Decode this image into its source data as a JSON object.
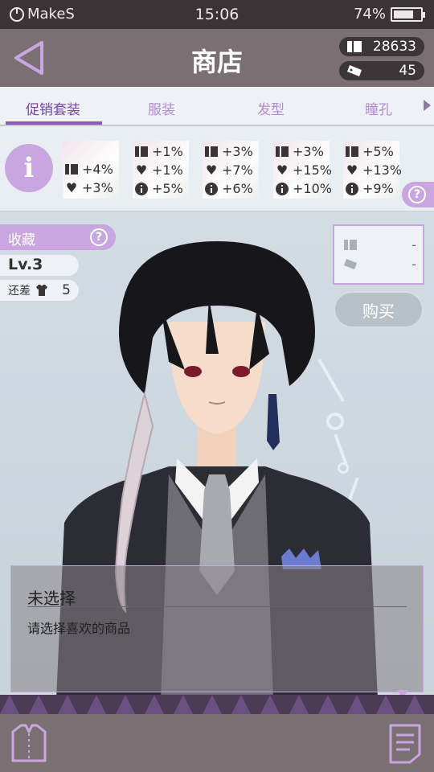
{
  "status_bar": {
    "carrier": "MakeS",
    "time": "15:06",
    "battery": "74%",
    "battery_level": 0.74
  },
  "header": {
    "title": "商店",
    "currency_1": {
      "icon": "card-icon",
      "value": "28633"
    },
    "currency_2": {
      "icon": "ticket-icon",
      "value": "45"
    }
  },
  "tabs": [
    {
      "label": "促销套装"
    },
    {
      "label": "服装"
    },
    {
      "label": "发型"
    },
    {
      "label": "瞳孔"
    }
  ],
  "bonus_cards": [
    {
      "lines": [
        {
          "icon": "card-icon",
          "text": "+4%"
        },
        {
          "icon": "heart-icon",
          "text": "+3%"
        }
      ]
    },
    {
      "lines": [
        {
          "icon": "card-icon",
          "text": "+1%"
        },
        {
          "icon": "heart-icon",
          "text": "+1%"
        },
        {
          "icon": "info-icon",
          "text": "+5%"
        }
      ]
    },
    {
      "lines": [
        {
          "icon": "card-icon",
          "text": "+3%"
        },
        {
          "icon": "heart-icon",
          "text": "+7%"
        },
        {
          "icon": "info-icon",
          "text": "+6%"
        }
      ]
    },
    {
      "lines": [
        {
          "icon": "card-icon",
          "text": "+3%"
        },
        {
          "icon": "heart-icon",
          "text": "+15%"
        },
        {
          "icon": "info-icon",
          "text": "+10%"
        }
      ]
    },
    {
      "lines": [
        {
          "icon": "card-icon",
          "text": "+5%"
        },
        {
          "icon": "heart-icon",
          "text": "+13%"
        },
        {
          "icon": "info-icon",
          "text": "+9%"
        }
      ]
    }
  ],
  "collection": {
    "label": "收藏",
    "level": "Lv.3",
    "remaining_label": "还差",
    "remaining_value": "5"
  },
  "price": {
    "card_value": "-",
    "ticket_value": "-"
  },
  "buy_label": "购买",
  "description": {
    "name": "未选择",
    "hint": "请选择喜欢的商品"
  },
  "colors": {
    "accent": "#c9a6e0",
    "accent_dark": "#7b43a8",
    "header": "#7a6f72"
  }
}
